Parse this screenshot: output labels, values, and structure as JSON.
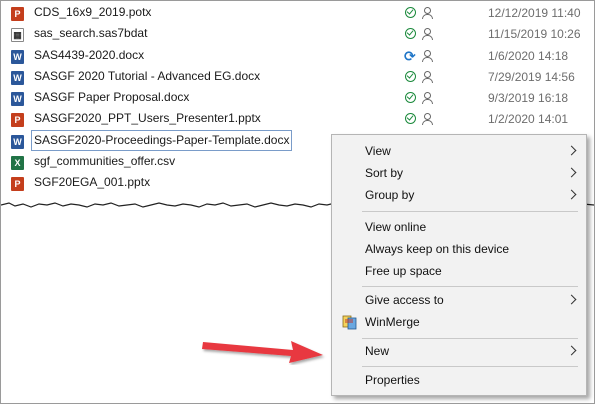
{
  "files": [
    {
      "name": "CDS_16x9_2019.potx",
      "type": "ppt",
      "icon": "powerpoint-icon",
      "status": "synced",
      "date": "12/12/2019 11:40"
    },
    {
      "name": "sas_search.sas7bdat",
      "type": "sas",
      "icon": "sas-dataset-icon",
      "status": "synced",
      "date": "11/15/2019 10:26"
    },
    {
      "name": "SAS4439-2020.docx",
      "type": "word",
      "icon": "word-icon",
      "status": "syncing",
      "date": "1/6/2020 14:18"
    },
    {
      "name": "SASGF 2020 Tutorial - Advanced EG.docx",
      "type": "word",
      "icon": "word-icon",
      "status": "synced",
      "date": "7/29/2019 14:56"
    },
    {
      "name": "SASGF Paper Proposal.docx",
      "type": "word",
      "icon": "word-icon",
      "status": "synced",
      "date": "9/3/2019 16:18"
    },
    {
      "name": "SASGF2020_PPT_Users_Presenter1.pptx",
      "type": "ppt",
      "icon": "powerpoint-icon",
      "status": "synced",
      "date": "1/2/2020 14:01"
    },
    {
      "name": "SASGF2020-Proceedings-Paper-Template.docx",
      "type": "word",
      "icon": "word-icon",
      "status": "",
      "date": "",
      "selected": true
    },
    {
      "name": "sgf_communities_offer.csv",
      "type": "excel",
      "icon": "excel-icon",
      "status": "",
      "date": ""
    },
    {
      "name": "SGF20EGA_001.pptx",
      "type": "ppt",
      "icon": "powerpoint-icon",
      "status": "",
      "date": ""
    }
  ],
  "context_menu": {
    "view": "View",
    "sort_by": "Sort by",
    "group_by": "Group by",
    "view_online": "View online",
    "always_keep": "Always keep on this device",
    "free_up_space": "Free up space",
    "give_access_to": "Give access to",
    "winmerge": "WinMerge",
    "new": "New",
    "properties": "Properties"
  },
  "colors": {
    "annotation_arrow": "#e8393f",
    "synced_green": "#1b8a3c",
    "sync_blue": "#1f75c7"
  }
}
